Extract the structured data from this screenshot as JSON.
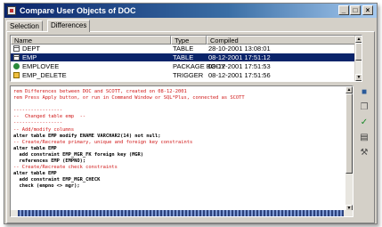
{
  "window": {
    "title": "Compare User Objects of DOC"
  },
  "titlebar_buttons": {
    "minimize": "_",
    "maximize": "□",
    "close": "×"
  },
  "tabs": [
    {
      "label": "Selection",
      "active": false
    },
    {
      "label": "Differences",
      "active": true
    }
  ],
  "list": {
    "columns": [
      "Name",
      "Type",
      "Compiled"
    ],
    "rows": [
      {
        "icon": "table-icon",
        "name": "DEPT",
        "type": "TABLE",
        "compiled": "28-10-2001 13:08:01",
        "selected": false
      },
      {
        "icon": "table-icon",
        "name": "EMP",
        "type": "TABLE",
        "compiled": "08-12-2001 17:51:12",
        "selected": true
      },
      {
        "icon": "package-body-icon",
        "name": "EMPLOVEE",
        "type": "PACKAGE BODY",
        "compiled": "08-12-2001 17:51:53",
        "selected": false
      },
      {
        "icon": "trigger-icon",
        "name": "EMP_DELETE",
        "type": "TRIGGER",
        "compiled": "08-12-2001 17:51:56",
        "selected": false
      }
    ]
  },
  "script_lines": [
    {
      "text": "rem Differences between DOC and SCOTT, created on 08-12-2001",
      "style": "comment"
    },
    {
      "text": "rem Press Apply button, or run in Command Window or SQL*Plus, connected as SCOTT",
      "style": "comment"
    },
    {
      "text": "",
      "style": "plain"
    },
    {
      "text": "-----------------",
      "style": "comment"
    },
    {
      "text": "--  Changed table emp  --",
      "style": "comment"
    },
    {
      "text": "-----------------",
      "style": "comment"
    },
    {
      "text": "-- Add/modify columns",
      "style": "comment"
    },
    {
      "text": "alter table EMP modify ENAME VARCHAR2(14) not null;",
      "style": "kw"
    },
    {
      "text": "-- Create/Recreate primary, unique and foreign key constraints",
      "style": "comment"
    },
    {
      "text": "alter table EMP",
      "style": "kw"
    },
    {
      "text": "  add constraint EMP_MGR_FK foreign key (MGR)",
      "style": "kw"
    },
    {
      "text": "  references EMP (EMPNO);",
      "style": "kw"
    },
    {
      "text": "-- Create/Recreate check constraints",
      "style": "comment"
    },
    {
      "text": "alter table EMP",
      "style": "kw"
    },
    {
      "text": "  add constraint EMP_MGR_CHECK",
      "style": "kw"
    },
    {
      "text": "  check (empno <> mgr);",
      "style": "kw"
    }
  ],
  "toolbar": [
    {
      "name": "save-icon",
      "glyph": "■",
      "color": "#2a5a9a"
    },
    {
      "name": "copy-icon",
      "glyph": "❐",
      "color": "#5a5a5a"
    },
    {
      "name": "apply-check-icon",
      "glyph": "✓",
      "color": "#1a8a2a"
    },
    {
      "name": "compare-icon",
      "glyph": "▤",
      "color": "#3a3a3a"
    },
    {
      "name": "tools-icon",
      "glyph": "⚒",
      "color": "#4a4a4a"
    }
  ],
  "colors": {
    "selected_row": "#0a246a",
    "comment": "#d01818"
  }
}
